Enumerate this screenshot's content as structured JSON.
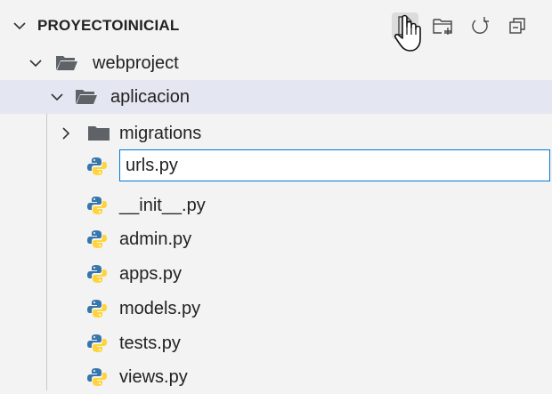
{
  "explorer": {
    "title": "PROYECTOINICIAL",
    "actions": [
      {
        "name": "new-file-icon"
      },
      {
        "name": "new-folder-icon"
      },
      {
        "name": "refresh-icon"
      },
      {
        "name": "collapse-all-icon"
      }
    ]
  },
  "tree": {
    "root_folder": "webproject",
    "app_folder": "aplicacion",
    "migrations_folder": "migrations",
    "rename_value": "urls.py",
    "files": [
      "__init__.py",
      "admin.py",
      "apps.py",
      "models.py",
      "tests.py",
      "views.py"
    ]
  },
  "colors": {
    "accent": "#0078d4",
    "selection": "#e4e6f1",
    "folder": "#5f6368",
    "python_blue": "#3776ab",
    "python_yellow": "#ffd43b"
  }
}
